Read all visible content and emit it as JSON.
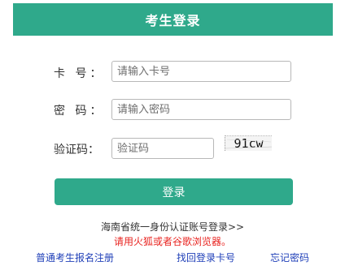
{
  "header": {
    "title": "考生登录"
  },
  "form": {
    "card_label": "卡 号：",
    "card_placeholder": "请输入卡号",
    "password_label": "密 码：",
    "password_placeholder": "请输入密码",
    "captcha_label": "验证码：",
    "captcha_placeholder": "验证码",
    "captcha_text": "91cw",
    "login_label": "登录"
  },
  "links": {
    "sso": "海南省统一身份认证账号登录>>",
    "browser_tip": "请用火狐或者谷歌浏览器。",
    "register": "普通考生报名注册",
    "find_card": "找回登录卡号",
    "forget_password": "忘记密码"
  },
  "colors": {
    "accent": "#2fa98b",
    "tip": "#e8231f",
    "link": "#1f3fb8"
  }
}
